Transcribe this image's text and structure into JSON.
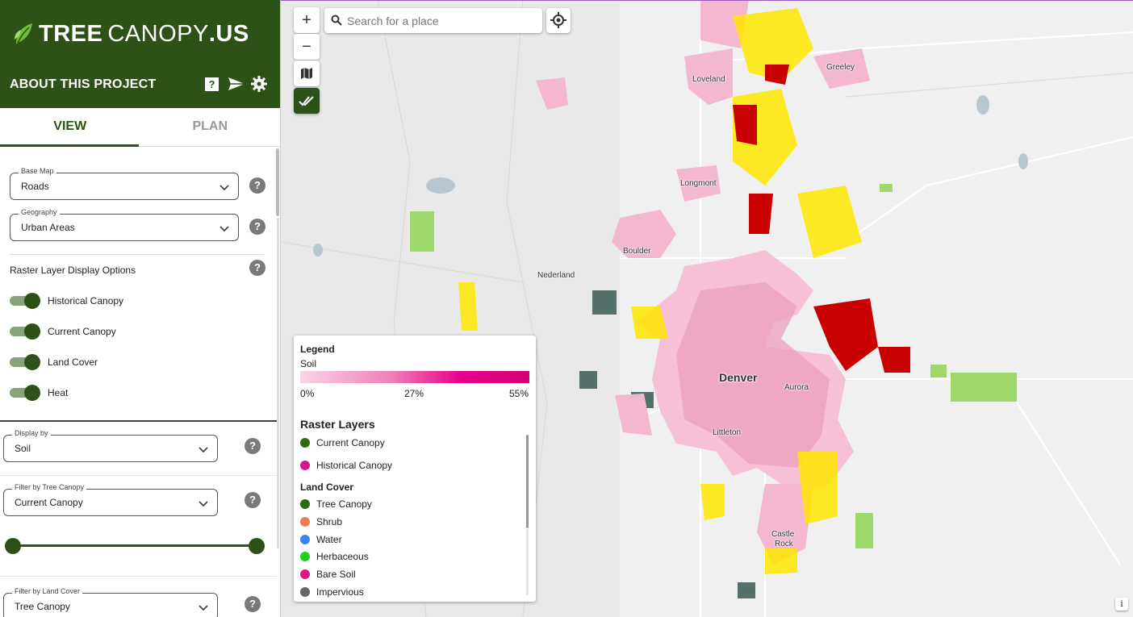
{
  "brand": {
    "word1": "TREE",
    "word2": "CANOPY",
    "word3": ".US"
  },
  "header": {
    "about": "ABOUT THIS PROJECT"
  },
  "tabs": [
    {
      "label": "VIEW"
    },
    {
      "label": "PLAN"
    }
  ],
  "base_map": {
    "label": "Base Map",
    "value": "Roads"
  },
  "geography": {
    "label": "Geography",
    "value": "Urban Areas"
  },
  "raster_options": {
    "title": "Raster Layer Display Options",
    "toggles": [
      {
        "label": "Historical Canopy",
        "on": true
      },
      {
        "label": "Current Canopy",
        "on": true
      },
      {
        "label": "Land Cover",
        "on": true
      },
      {
        "label": "Heat",
        "on": true
      }
    ]
  },
  "display_by": {
    "label": "Display by",
    "value": "Soil"
  },
  "filter_canopy": {
    "label": "Filter by Tree Canopy",
    "value": "Current Canopy"
  },
  "filter_landcover": {
    "label": "Filter by Land Cover",
    "value": "Tree Canopy"
  },
  "help_glyph": "?",
  "map": {
    "search_placeholder": "Search for a place",
    "zoom_in": "+",
    "zoom_out": "−",
    "info": "i",
    "cities": {
      "loveland": "Loveland",
      "greeley": "Greeley",
      "longmont": "Longmont",
      "boulder": "Boulder",
      "nederland": "Nederland",
      "denver": "Denver",
      "aurora": "Aurora",
      "littleton": "Littleton",
      "castle_rock_1": "Castle",
      "castle_rock_2": "Rock"
    }
  },
  "legend": {
    "title": "Legend",
    "layer": "Soil",
    "ticks": [
      "0%",
      "27%",
      "55%"
    ],
    "raster_title": "Raster Layers",
    "raster_items": [
      {
        "label": "Current Canopy",
        "color": "#2d6a12"
      },
      {
        "label": "Historical Canopy",
        "color": "#d6178c"
      }
    ],
    "landcover_title": "Land Cover",
    "landcover_items": [
      {
        "label": "Tree Canopy",
        "color": "#2d6a12"
      },
      {
        "label": "Shrub",
        "color": "#f47c4c"
      },
      {
        "label": "Water",
        "color": "#3b82f0"
      },
      {
        "label": "Herbaceous",
        "color": "#1fd01f"
      },
      {
        "label": "Bare Soil",
        "color": "#d6178c"
      },
      {
        "label": "Impervious",
        "color": "#666666"
      }
    ]
  },
  "colors": {
    "brand_green": "#2d5218",
    "soil_pink": "#e6008c",
    "heat_red": "#c80000",
    "heat_yellow": "#ffe600"
  }
}
